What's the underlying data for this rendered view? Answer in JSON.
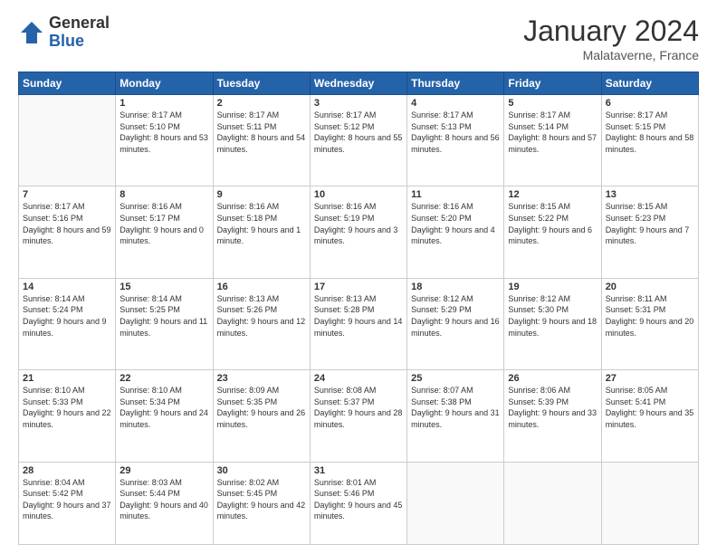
{
  "logo": {
    "general": "General",
    "blue": "Blue"
  },
  "header": {
    "title": "January 2024",
    "subtitle": "Malataverne, France"
  },
  "columns": [
    "Sunday",
    "Monday",
    "Tuesday",
    "Wednesday",
    "Thursday",
    "Friday",
    "Saturday"
  ],
  "weeks": [
    [
      {
        "day": "",
        "sunrise": "",
        "sunset": "",
        "daylight": ""
      },
      {
        "day": "1",
        "sunrise": "Sunrise: 8:17 AM",
        "sunset": "Sunset: 5:10 PM",
        "daylight": "Daylight: 8 hours and 53 minutes."
      },
      {
        "day": "2",
        "sunrise": "Sunrise: 8:17 AM",
        "sunset": "Sunset: 5:11 PM",
        "daylight": "Daylight: 8 hours and 54 minutes."
      },
      {
        "day": "3",
        "sunrise": "Sunrise: 8:17 AM",
        "sunset": "Sunset: 5:12 PM",
        "daylight": "Daylight: 8 hours and 55 minutes."
      },
      {
        "day": "4",
        "sunrise": "Sunrise: 8:17 AM",
        "sunset": "Sunset: 5:13 PM",
        "daylight": "Daylight: 8 hours and 56 minutes."
      },
      {
        "day": "5",
        "sunrise": "Sunrise: 8:17 AM",
        "sunset": "Sunset: 5:14 PM",
        "daylight": "Daylight: 8 hours and 57 minutes."
      },
      {
        "day": "6",
        "sunrise": "Sunrise: 8:17 AM",
        "sunset": "Sunset: 5:15 PM",
        "daylight": "Daylight: 8 hours and 58 minutes."
      }
    ],
    [
      {
        "day": "7",
        "sunrise": "Sunrise: 8:17 AM",
        "sunset": "Sunset: 5:16 PM",
        "daylight": "Daylight: 8 hours and 59 minutes."
      },
      {
        "day": "8",
        "sunrise": "Sunrise: 8:16 AM",
        "sunset": "Sunset: 5:17 PM",
        "daylight": "Daylight: 9 hours and 0 minutes."
      },
      {
        "day": "9",
        "sunrise": "Sunrise: 8:16 AM",
        "sunset": "Sunset: 5:18 PM",
        "daylight": "Daylight: 9 hours and 1 minute."
      },
      {
        "day": "10",
        "sunrise": "Sunrise: 8:16 AM",
        "sunset": "Sunset: 5:19 PM",
        "daylight": "Daylight: 9 hours and 3 minutes."
      },
      {
        "day": "11",
        "sunrise": "Sunrise: 8:16 AM",
        "sunset": "Sunset: 5:20 PM",
        "daylight": "Daylight: 9 hours and 4 minutes."
      },
      {
        "day": "12",
        "sunrise": "Sunrise: 8:15 AM",
        "sunset": "Sunset: 5:22 PM",
        "daylight": "Daylight: 9 hours and 6 minutes."
      },
      {
        "day": "13",
        "sunrise": "Sunrise: 8:15 AM",
        "sunset": "Sunset: 5:23 PM",
        "daylight": "Daylight: 9 hours and 7 minutes."
      }
    ],
    [
      {
        "day": "14",
        "sunrise": "Sunrise: 8:14 AM",
        "sunset": "Sunset: 5:24 PM",
        "daylight": "Daylight: 9 hours and 9 minutes."
      },
      {
        "day": "15",
        "sunrise": "Sunrise: 8:14 AM",
        "sunset": "Sunset: 5:25 PM",
        "daylight": "Daylight: 9 hours and 11 minutes."
      },
      {
        "day": "16",
        "sunrise": "Sunrise: 8:13 AM",
        "sunset": "Sunset: 5:26 PM",
        "daylight": "Daylight: 9 hours and 12 minutes."
      },
      {
        "day": "17",
        "sunrise": "Sunrise: 8:13 AM",
        "sunset": "Sunset: 5:28 PM",
        "daylight": "Daylight: 9 hours and 14 minutes."
      },
      {
        "day": "18",
        "sunrise": "Sunrise: 8:12 AM",
        "sunset": "Sunset: 5:29 PM",
        "daylight": "Daylight: 9 hours and 16 minutes."
      },
      {
        "day": "19",
        "sunrise": "Sunrise: 8:12 AM",
        "sunset": "Sunset: 5:30 PM",
        "daylight": "Daylight: 9 hours and 18 minutes."
      },
      {
        "day": "20",
        "sunrise": "Sunrise: 8:11 AM",
        "sunset": "Sunset: 5:31 PM",
        "daylight": "Daylight: 9 hours and 20 minutes."
      }
    ],
    [
      {
        "day": "21",
        "sunrise": "Sunrise: 8:10 AM",
        "sunset": "Sunset: 5:33 PM",
        "daylight": "Daylight: 9 hours and 22 minutes."
      },
      {
        "day": "22",
        "sunrise": "Sunrise: 8:10 AM",
        "sunset": "Sunset: 5:34 PM",
        "daylight": "Daylight: 9 hours and 24 minutes."
      },
      {
        "day": "23",
        "sunrise": "Sunrise: 8:09 AM",
        "sunset": "Sunset: 5:35 PM",
        "daylight": "Daylight: 9 hours and 26 minutes."
      },
      {
        "day": "24",
        "sunrise": "Sunrise: 8:08 AM",
        "sunset": "Sunset: 5:37 PM",
        "daylight": "Daylight: 9 hours and 28 minutes."
      },
      {
        "day": "25",
        "sunrise": "Sunrise: 8:07 AM",
        "sunset": "Sunset: 5:38 PM",
        "daylight": "Daylight: 9 hours and 31 minutes."
      },
      {
        "day": "26",
        "sunrise": "Sunrise: 8:06 AM",
        "sunset": "Sunset: 5:39 PM",
        "daylight": "Daylight: 9 hours and 33 minutes."
      },
      {
        "day": "27",
        "sunrise": "Sunrise: 8:05 AM",
        "sunset": "Sunset: 5:41 PM",
        "daylight": "Daylight: 9 hours and 35 minutes."
      }
    ],
    [
      {
        "day": "28",
        "sunrise": "Sunrise: 8:04 AM",
        "sunset": "Sunset: 5:42 PM",
        "daylight": "Daylight: 9 hours and 37 minutes."
      },
      {
        "day": "29",
        "sunrise": "Sunrise: 8:03 AM",
        "sunset": "Sunset: 5:44 PM",
        "daylight": "Daylight: 9 hours and 40 minutes."
      },
      {
        "day": "30",
        "sunrise": "Sunrise: 8:02 AM",
        "sunset": "Sunset: 5:45 PM",
        "daylight": "Daylight: 9 hours and 42 minutes."
      },
      {
        "day": "31",
        "sunrise": "Sunrise: 8:01 AM",
        "sunset": "Sunset: 5:46 PM",
        "daylight": "Daylight: 9 hours and 45 minutes."
      },
      {
        "day": "",
        "sunrise": "",
        "sunset": "",
        "daylight": ""
      },
      {
        "day": "",
        "sunrise": "",
        "sunset": "",
        "daylight": ""
      },
      {
        "day": "",
        "sunrise": "",
        "sunset": "",
        "daylight": ""
      }
    ]
  ]
}
